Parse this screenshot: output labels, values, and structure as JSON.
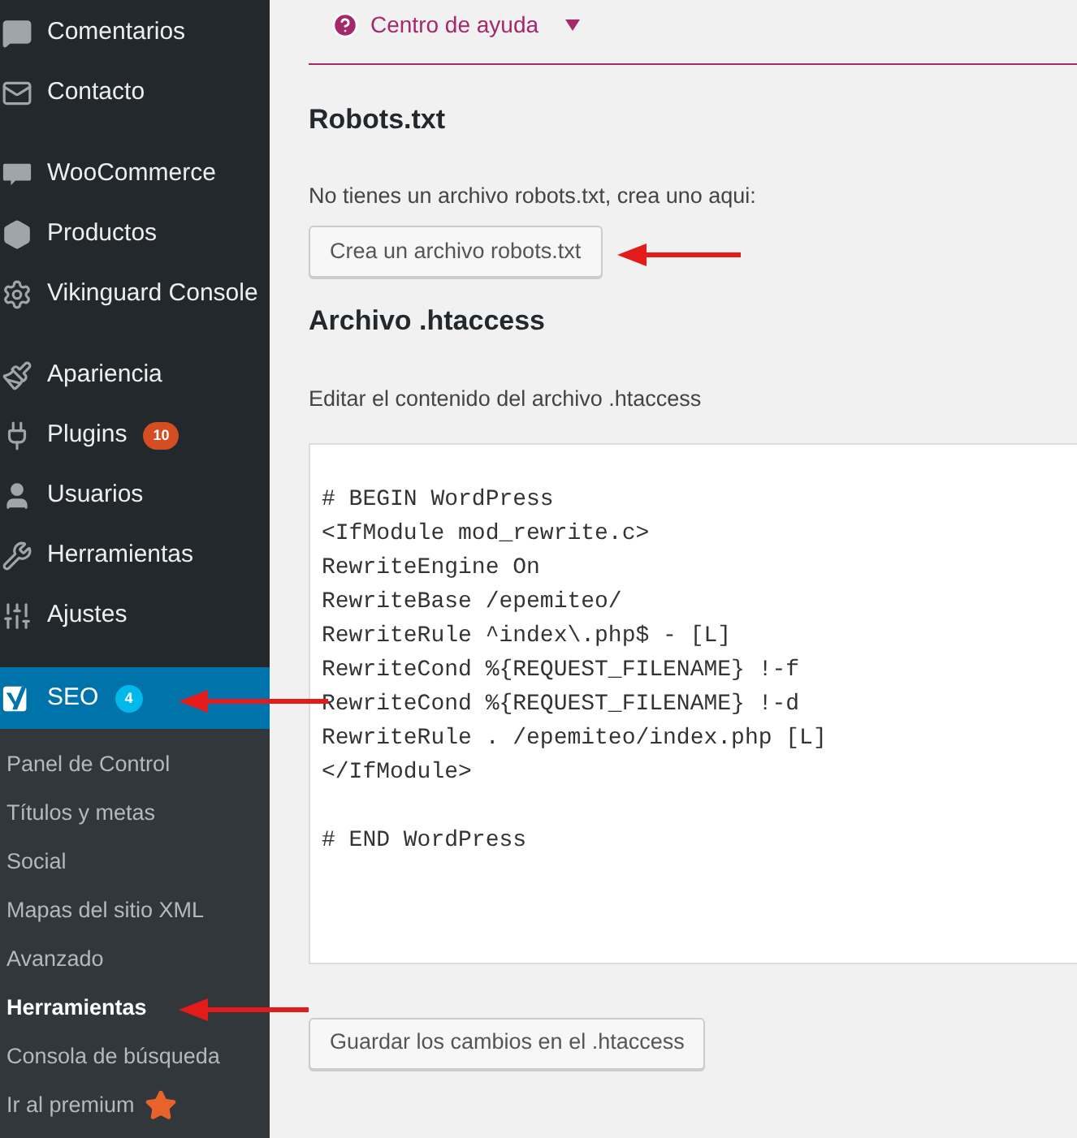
{
  "sidebar": {
    "menu_groups": [
      [
        {
          "label": "Comentarios",
          "selected": false
        },
        {
          "label": "Contacto",
          "selected": false
        }
      ],
      [
        {
          "label": "WooCommerce",
          "selected": false
        },
        {
          "label": "Productos",
          "selected": false
        },
        {
          "label": "Vikinguard Console",
          "selected": false
        }
      ],
      [
        {
          "label": "Apariencia",
          "selected": false
        },
        {
          "label": "Plugins",
          "selected": false,
          "badge": "10",
          "color": "#d54e21"
        },
        {
          "label": "Usuarios",
          "selected": false
        },
        {
          "label": "Herramientas",
          "selected": false
        },
        {
          "label": "Ajustes",
          "selected": false
        }
      ],
      [
        {
          "label": "SEO",
          "selected": true,
          "badge": "4",
          "color": "#00b9eb"
        }
      ]
    ],
    "submenu": [
      {
        "label": "Panel de Control",
        "selected": false,
        "kind": "link"
      },
      {
        "label": "Títulos y metas",
        "selected": false,
        "kind": "link"
      },
      {
        "label": "Social",
        "selected": false,
        "kind": "link"
      },
      {
        "label": "Mapas del sitio XML",
        "selected": false,
        "kind": "link"
      },
      {
        "label": "Avanzado",
        "selected": false,
        "kind": "link"
      },
      {
        "label": "Herramientas",
        "selected": true,
        "kind": "link"
      },
      {
        "label": "Consola de búsqueda",
        "selected": false,
        "kind": "link"
      },
      {
        "label": "Ir al premium",
        "selected": false,
        "kind": "premium"
      }
    ]
  },
  "help_menu": {
    "label": "Centro de ayuda"
  },
  "robots": {
    "heading": "Robots.txt",
    "text": "No tienes un archivo robots.txt, crea uno aqui:",
    "button": "Crea un archivo robots.txt"
  },
  "htaccess": {
    "heading": "Archivo .htaccess",
    "text": "Editar el contenido del archivo .htaccess",
    "blocks": [
      [
        "# BEGIN WordPress",
        "<IfModule mod_rewrite.c>",
        "RewriteEngine On",
        "RewriteBase /epemiteo/",
        "RewriteRule ^index\\.php$ - [L]",
        "RewriteCond %{REQUEST_FILENAME} !-f",
        "RewriteCond %{REQUEST_FILENAME} !-d",
        "RewriteRule . /epemiteo/index.php [L]",
        "</IfModule>"
      ],
      [
        "# END WordPress"
      ]
    ],
    "button": "Guardar los cambios en el .htaccess"
  }
}
